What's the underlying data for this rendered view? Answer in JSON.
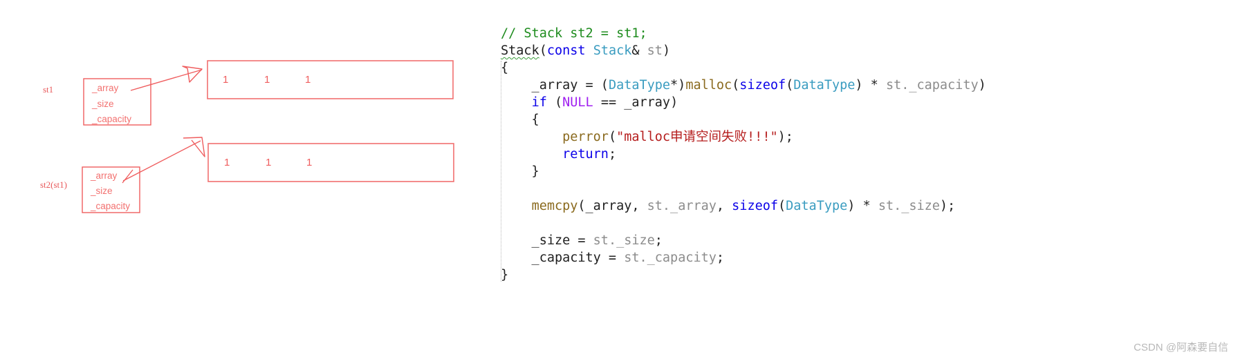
{
  "diagram": {
    "objects": [
      {
        "name": "st1",
        "fields": [
          "_array",
          "_size",
          "_capacity"
        ],
        "array_cells": [
          "1",
          "1",
          "1"
        ]
      },
      {
        "name": "st2(st1)",
        "fields": [
          "_array",
          "_size",
          "_capacity"
        ],
        "array_cells": [
          "1",
          "1",
          "1"
        ]
      }
    ],
    "annotation_color": "#ef5d5e"
  },
  "code": {
    "language": "cpp",
    "lines": [
      [
        {
          "t": "// Stack st2 = st1;",
          "c": "com"
        }
      ],
      [
        {
          "t": "Stack",
          "c": "plain",
          "squiggle": true
        },
        {
          "t": "(",
          "c": "punc"
        },
        {
          "t": "const",
          "c": "kw"
        },
        {
          "t": " ",
          "c": "plain"
        },
        {
          "t": "Stack",
          "c": "type"
        },
        {
          "t": "& ",
          "c": "plain"
        },
        {
          "t": "st",
          "c": "param"
        },
        {
          "t": ")",
          "c": "punc"
        }
      ],
      [
        {
          "t": "{",
          "c": "punc"
        }
      ],
      [
        {
          "t": "    _array = (",
          "c": "plain"
        },
        {
          "t": "DataType",
          "c": "type"
        },
        {
          "t": "*)",
          "c": "plain"
        },
        {
          "t": "malloc",
          "c": "fn"
        },
        {
          "t": "(",
          "c": "punc"
        },
        {
          "t": "sizeof",
          "c": "kw"
        },
        {
          "t": "(",
          "c": "punc"
        },
        {
          "t": "DataType",
          "c": "type"
        },
        {
          "t": ") * ",
          "c": "plain"
        },
        {
          "t": "st",
          "c": "param"
        },
        {
          "t": "._capacity",
          "c": "param"
        },
        {
          "t": ")",
          "c": "punc"
        }
      ],
      [
        {
          "t": "    ",
          "c": "plain"
        },
        {
          "t": "if",
          "c": "kw"
        },
        {
          "t": " (",
          "c": "punc"
        },
        {
          "t": "NULL",
          "c": "macro"
        },
        {
          "t": " == _array)",
          "c": "plain"
        }
      ],
      [
        {
          "t": "    {",
          "c": "punc"
        }
      ],
      [
        {
          "t": "        ",
          "c": "plain"
        },
        {
          "t": "perror",
          "c": "fn"
        },
        {
          "t": "(",
          "c": "punc"
        },
        {
          "t": "\"malloc申请空间失败!!!\"",
          "c": "str"
        },
        {
          "t": ");",
          "c": "punc"
        }
      ],
      [
        {
          "t": "        ",
          "c": "plain"
        },
        {
          "t": "return",
          "c": "kw"
        },
        {
          "t": ";",
          "c": "punc"
        }
      ],
      [
        {
          "t": "    }",
          "c": "punc"
        }
      ],
      [],
      [
        {
          "t": "    ",
          "c": "plain"
        },
        {
          "t": "memcpy",
          "c": "fn"
        },
        {
          "t": "(_array, ",
          "c": "plain"
        },
        {
          "t": "st",
          "c": "param"
        },
        {
          "t": "._array",
          "c": "param"
        },
        {
          "t": ", ",
          "c": "plain"
        },
        {
          "t": "sizeof",
          "c": "kw"
        },
        {
          "t": "(",
          "c": "punc"
        },
        {
          "t": "DataType",
          "c": "type"
        },
        {
          "t": ") * ",
          "c": "plain"
        },
        {
          "t": "st",
          "c": "param"
        },
        {
          "t": "._size",
          "c": "param"
        },
        {
          "t": ");",
          "c": "punc"
        }
      ],
      [],
      [
        {
          "t": "    _size = ",
          "c": "plain"
        },
        {
          "t": "st",
          "c": "param"
        },
        {
          "t": "._size",
          "c": "param"
        },
        {
          "t": ";",
          "c": "punc"
        }
      ],
      [
        {
          "t": "    _capacity = ",
          "c": "plain"
        },
        {
          "t": "st",
          "c": "param"
        },
        {
          "t": "._capacity",
          "c": "param"
        },
        {
          "t": ";",
          "c": "punc"
        }
      ],
      [
        {
          "t": "}",
          "c": "punc"
        }
      ]
    ],
    "colors": {
      "comment": "#1e8c1e",
      "keyword": "#0b00e8",
      "type": "#3a9cc0",
      "function": "#8a6a1e",
      "string": "#b51d1d",
      "macro": "#a020f0",
      "parameter": "#8c8c8c",
      "plain": "#1f1f1f"
    }
  },
  "watermark": {
    "text": "CSDN @阿森要自信"
  }
}
